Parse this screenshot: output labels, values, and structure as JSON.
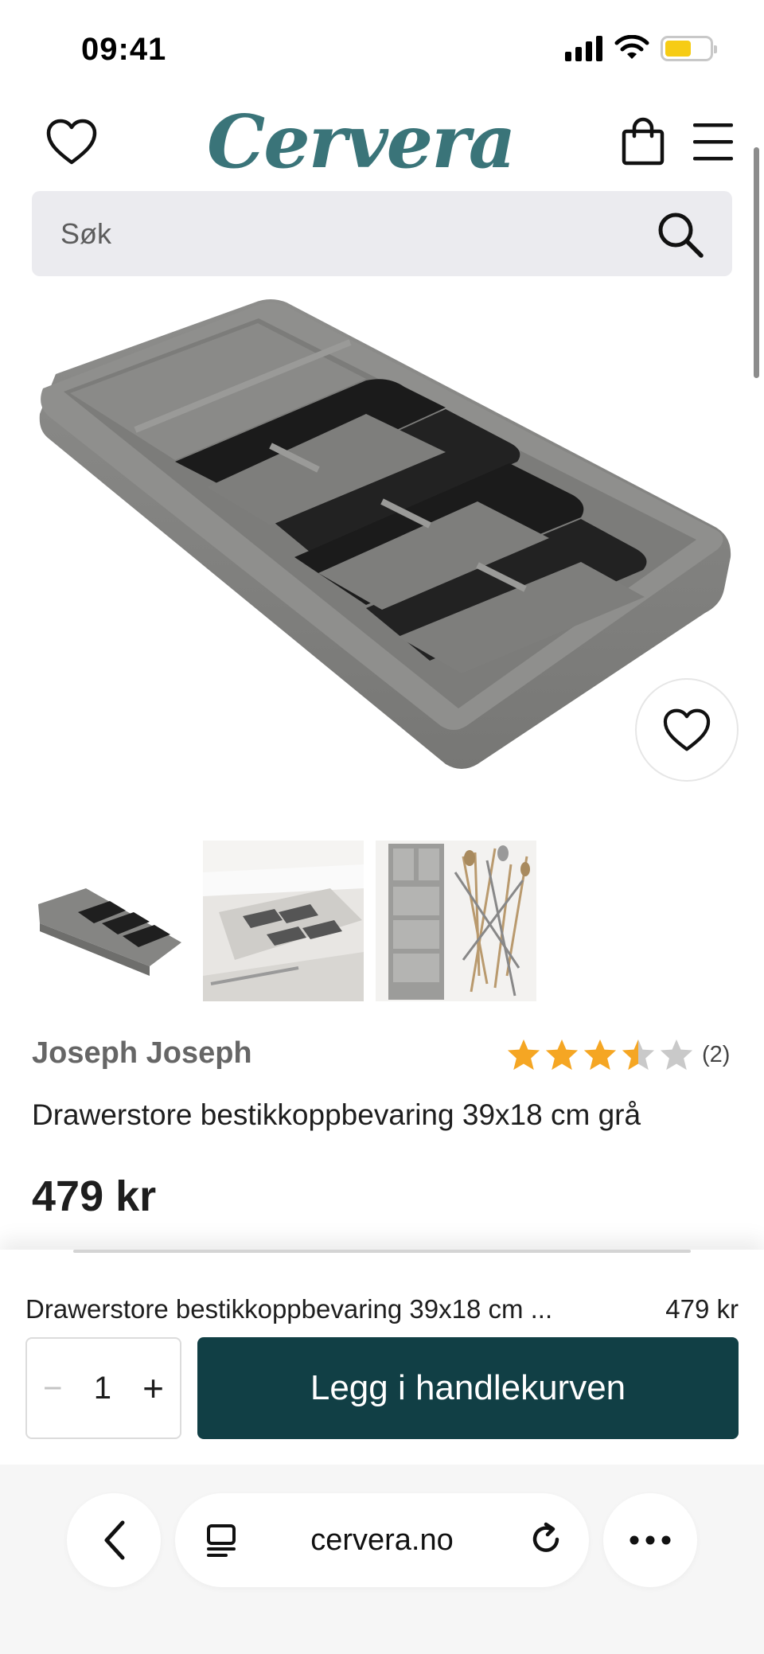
{
  "status_bar": {
    "time": "09:41",
    "battery_color": "#f6cc15"
  },
  "header": {
    "logo": "Cervera",
    "logo_color": "#3a7479"
  },
  "search": {
    "placeholder": "Søk"
  },
  "product": {
    "brand": "Joseph Joseph",
    "rating": {
      "value": 3.5,
      "max": 5,
      "count_label": "(2)",
      "star_color": "#f5a623"
    },
    "title": "Drawerstore bestikkoppbevaring 39x18 cm grå",
    "price": "479 kr",
    "thumbnails": [
      "thumbnail-1",
      "thumbnail-2",
      "thumbnail-3"
    ]
  },
  "sticky_bar": {
    "name": "Drawerstore bestikkoppbevaring 39x18 cm ...",
    "price": "479 kr",
    "quantity": "1",
    "minus_label": "−",
    "plus_label": "+",
    "add_to_cart_label": "Legg i handlekurven",
    "button_color": "#113f45"
  },
  "browser": {
    "url": "cervera.no",
    "more_label": "···"
  }
}
